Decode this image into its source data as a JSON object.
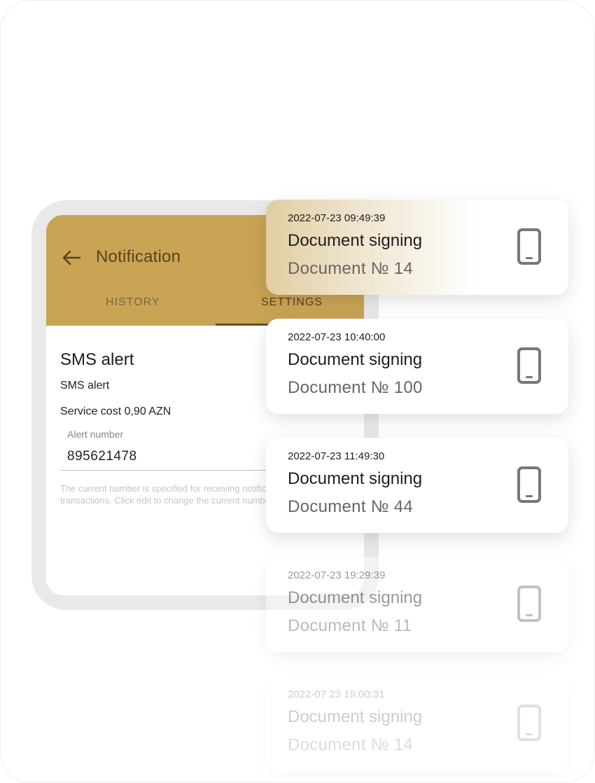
{
  "app": {
    "title": "Notification",
    "tabs": [
      {
        "label": "HISTORY",
        "active": false
      },
      {
        "label": "SETTINGS",
        "active": true
      }
    ],
    "accent_color": "#c8a454"
  },
  "settings": {
    "section_title": "SMS alert",
    "subtitle": "SMS alert",
    "service_cost": "Service cost 0,90 AZN",
    "alert_number_label": "Alert number",
    "alert_number_value": "895621478",
    "hint": "The current number is specified for receiving notifications about card transactions. Click edit to change the current number."
  },
  "notifications": [
    {
      "time": "2022-07-23 09:49:39",
      "title": "Document signing",
      "document": "Document № 14",
      "icon": "smartphone-icon"
    },
    {
      "time": "2022-07-23 10:40:00",
      "title": "Document signing",
      "document": "Document № 100",
      "icon": "smartphone-icon"
    },
    {
      "time": "2022-07-23 11:49:30",
      "title": "Document signing",
      "document": "Document № 44",
      "icon": "smartphone-icon"
    },
    {
      "time": "2022-07-23 19:29:39",
      "title": "Document signing",
      "document": "Document № 11",
      "icon": "smartphone-icon"
    },
    {
      "time": "2022-07 23 19:00:31",
      "title": "Document signing",
      "document": "Document № 14",
      "icon": "smartphone-icon"
    }
  ]
}
